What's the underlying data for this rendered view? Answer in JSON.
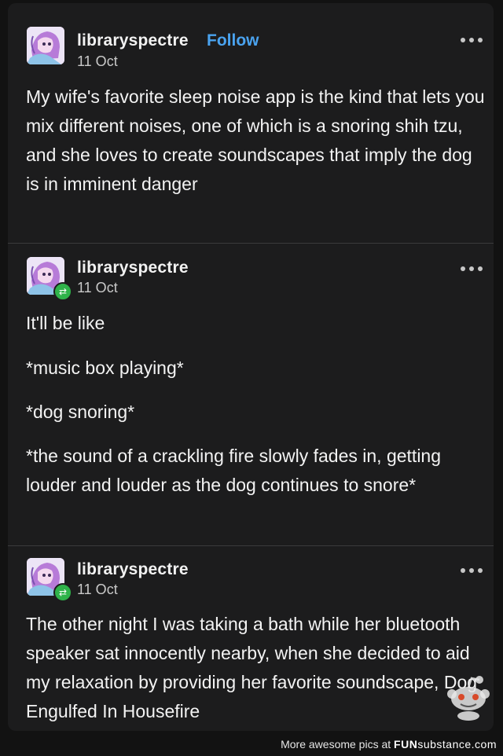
{
  "posts": [
    {
      "username": "libraryspectre",
      "follow_label": "Follow",
      "date": "11 Oct",
      "paragraphs": [
        "My wife's favorite sleep noise app is the kind that lets you mix different noises, one of which is a snoring shih tzu, and she loves to create soundscapes that imply the dog is in imminent danger"
      ]
    },
    {
      "username": "libraryspectre",
      "date": "11 Oct",
      "paragraphs": [
        "It'll be like",
        "*music box playing*",
        "*dog snoring*",
        "*the sound of a crackling fire slowly fades in, getting louder and louder as the dog continues to snore*"
      ]
    },
    {
      "username": "libraryspectre",
      "date": "11 Oct",
      "paragraphs": [
        "The other night I was taking a bath while her bluetooth speaker sat innocently nearby, when she decided to aid my relaxation by  providing her favorite soundscape, Dog Engulfed In Housefire"
      ]
    }
  ],
  "footer": {
    "prefix": "More awesome pics at ",
    "brand_fun": "FUN",
    "brand_rest": "substance.com"
  },
  "icons": {
    "more": "more-options-icon",
    "reblog": "reblog-icon",
    "mascot": "reddit-snoo-icon"
  },
  "colors": {
    "follow": "#4aa3f0",
    "reblog_badge": "#2fb34a",
    "card_bg": "#1c1c1d"
  }
}
